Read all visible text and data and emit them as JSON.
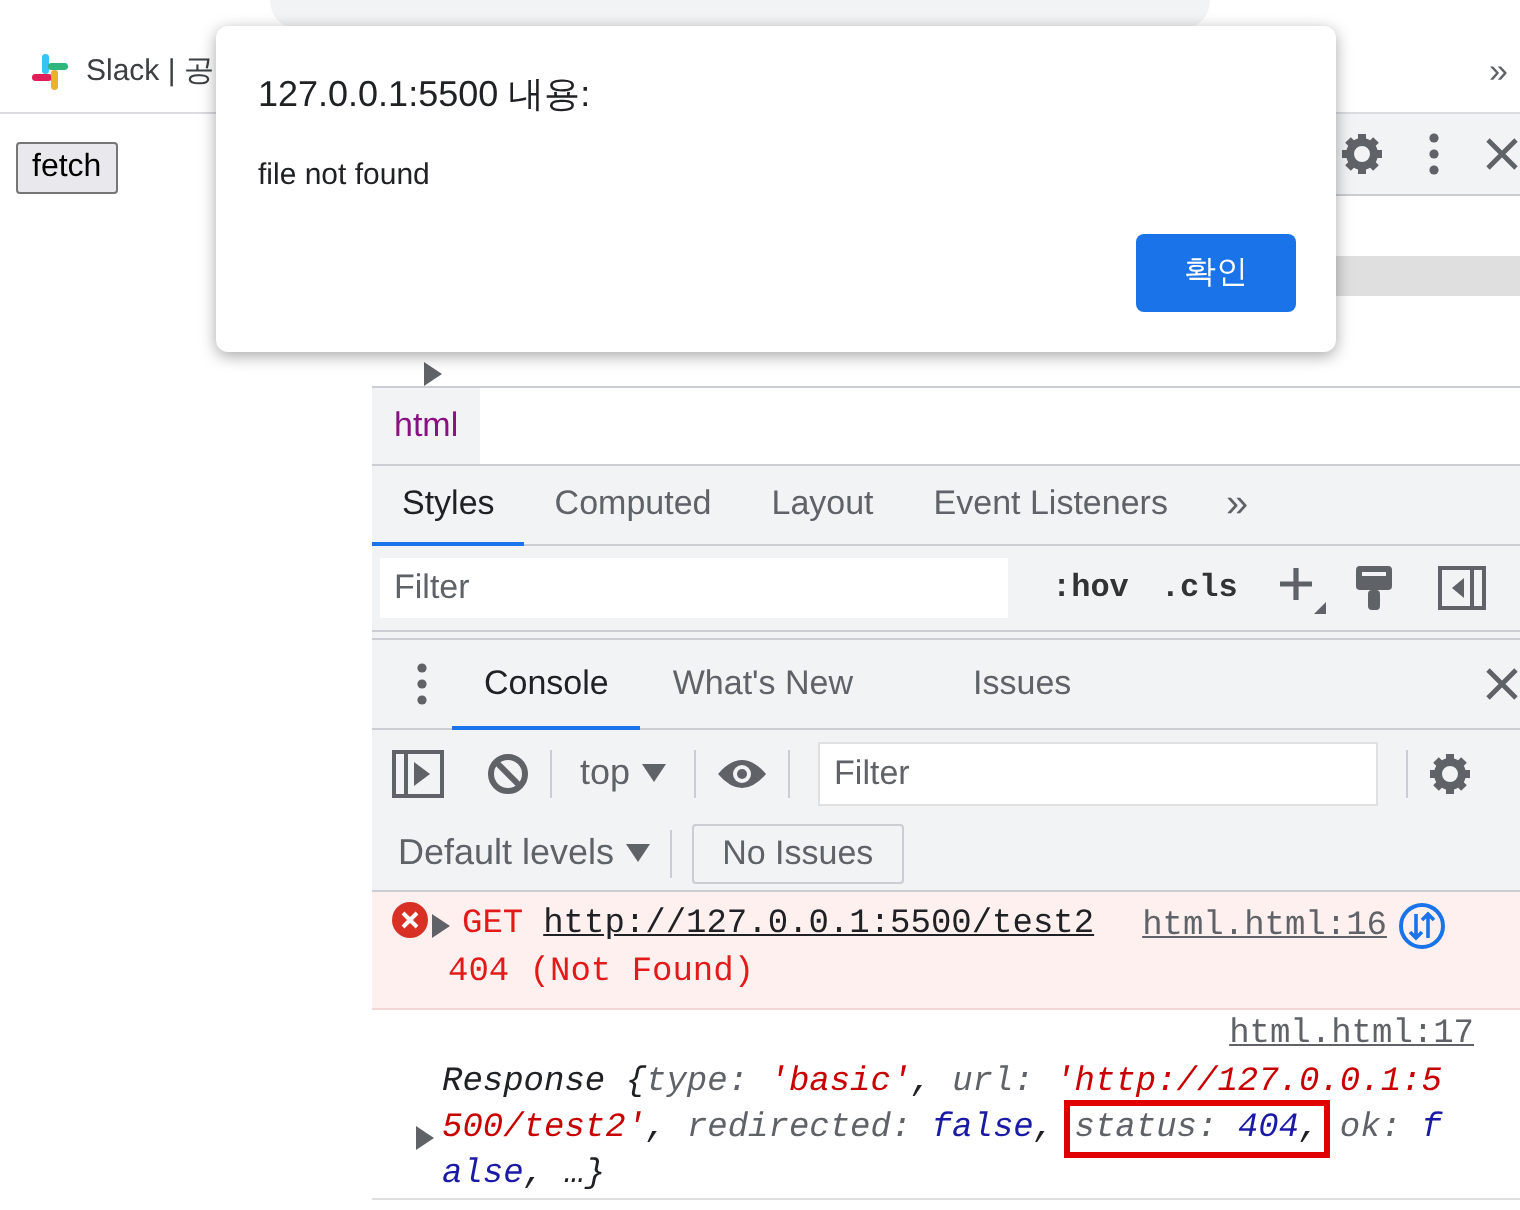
{
  "browser": {
    "bookmarks": [
      {
        "label": "Slack | 공"
      }
    ],
    "overflow": "»"
  },
  "page": {
    "button": "fetch"
  },
  "devtools": {
    "breadcrumb": "html",
    "sidebar_tabs": [
      {
        "label": "Styles",
        "selected": true
      },
      {
        "label": "Computed",
        "selected": false
      },
      {
        "label": "Layout",
        "selected": false
      },
      {
        "label": "Event Listeners",
        "selected": false
      }
    ],
    "sidebar_more": "»",
    "styles_filter": {
      "placeholder": "Filter"
    },
    "style_buttons": [
      ":hov",
      ".cls"
    ],
    "drawer_tabs": [
      {
        "label": "Console",
        "selected": true
      },
      {
        "label": "What's New",
        "selected": false
      },
      {
        "label": "Issues",
        "selected": false
      }
    ],
    "context": "top",
    "console_filter": {
      "placeholder": "Filter"
    },
    "levels": "Default levels",
    "issues_button": "No Issues",
    "messages": [
      {
        "kind": "error",
        "method": "GET",
        "url": "http://127.0.0.1:5500/test2",
        "status_text": "404 (Not Found)",
        "source": "html.html:16"
      },
      {
        "kind": "log",
        "source": "html.html:17",
        "preview": [
          {
            "kind": "text",
            "tokens": [
              {
                "kind": "plain",
                "text": "Response {"
              },
              {
                "kind": "key",
                "text": "type: "
              },
              {
                "kind": "string",
                "text": "'basic'"
              },
              {
                "kind": "plain",
                "text": ", "
              },
              {
                "kind": "key",
                "text": "url: "
              },
              {
                "kind": "string",
                "text": "'http://127.0.0.1:5500/test2'"
              },
              {
                "kind": "plain",
                "text": ", "
              },
              {
                "kind": "key",
                "text": "redirected: "
              },
              {
                "kind": "value",
                "text": "false"
              },
              {
                "kind": "plain",
                "text": ", "
              }
            ]
          },
          {
            "kind": "highlight",
            "tokens": [
              {
                "kind": "key",
                "text": "status: "
              },
              {
                "kind": "value",
                "text": "404"
              },
              {
                "kind": "plain",
                "text": ","
              }
            ]
          },
          {
            "kind": "text",
            "tokens": [
              {
                "kind": "key",
                "text": " ok: "
              },
              {
                "kind": "value",
                "text": "false"
              },
              {
                "kind": "plain",
                "text": ", …}"
              }
            ]
          }
        ]
      }
    ]
  },
  "dialog": {
    "title": "127.0.0.1:5500 내용:",
    "message": "file not found",
    "button": "확인"
  }
}
